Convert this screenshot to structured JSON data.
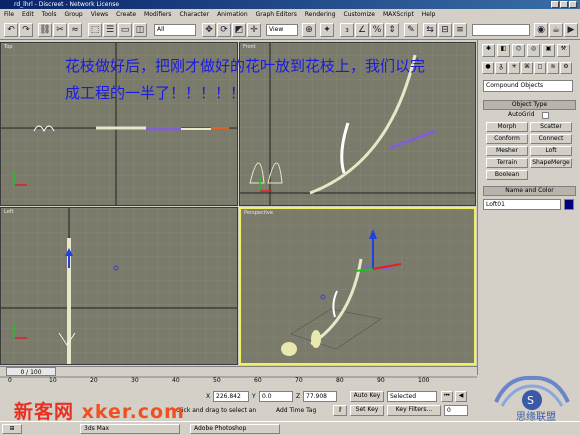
{
  "window": {
    "title": "rd_lhrl - Discreet - Network License"
  },
  "menu": [
    "File",
    "Edit",
    "Tools",
    "Group",
    "Views",
    "Create",
    "Modifiers",
    "Character",
    "Animation",
    "Graph Editors",
    "Rendering",
    "Customize",
    "MAXScript",
    "Help"
  ],
  "toolbar": {
    "selection_filter": "All",
    "view_dropdown": "View",
    "named_selection": ""
  },
  "overlay_note": {
    "line1": "花枝做好后，把刚才做好的花叶放到花枝上，我们以完",
    "line2": "成工程的一半了！！！！！"
  },
  "viewports": {
    "top": {
      "label": "Top"
    },
    "front": {
      "label": "Front"
    },
    "left": {
      "label": "Left"
    },
    "perspective": {
      "label": "Perspective"
    }
  },
  "command_panel": {
    "category_dropdown": "Compound Objects",
    "object_type_title": "Object Type",
    "autogrid_label": "AutoGrid",
    "buttons": [
      "Morph",
      "Scatter",
      "Conform",
      "Connect",
      "Mesher",
      "Loft",
      "Terrain",
      "ShapeMerge",
      "Boolean"
    ],
    "name_color_title": "Name and Color",
    "name_value": "Loft01",
    "object_color": "#000080"
  },
  "time": {
    "slider_label": "0 / 100",
    "ticks": [
      "0",
      "10",
      "20",
      "30",
      "40",
      "50",
      "60",
      "70",
      "80",
      "90",
      "100"
    ]
  },
  "status": {
    "x_label": "X",
    "x_value": "226.842",
    "y_label": "Y",
    "y_value": "0.0",
    "z_label": "Z",
    "z_value": "77.908",
    "autokey": "Auto Key",
    "set_key": "Set Key",
    "selected": "Selected",
    "key_filters": "Key Filters...",
    "prompt": "Click and drag to select an",
    "add_time_tag": "Add Time Tag",
    "frame": "0"
  },
  "taskbar": {
    "task1": "3ds Max",
    "task2": "Adobe Photoshop"
  },
  "watermark": {
    "site": "新客网",
    "domain": "xker.com",
    "brand": "思缘联盟"
  },
  "colors": {
    "viewport_bg": "#7b7b6b",
    "active_border": "#f0f060",
    "overlay_text": "#1a1ae0",
    "watermark_red": "#e83020"
  }
}
